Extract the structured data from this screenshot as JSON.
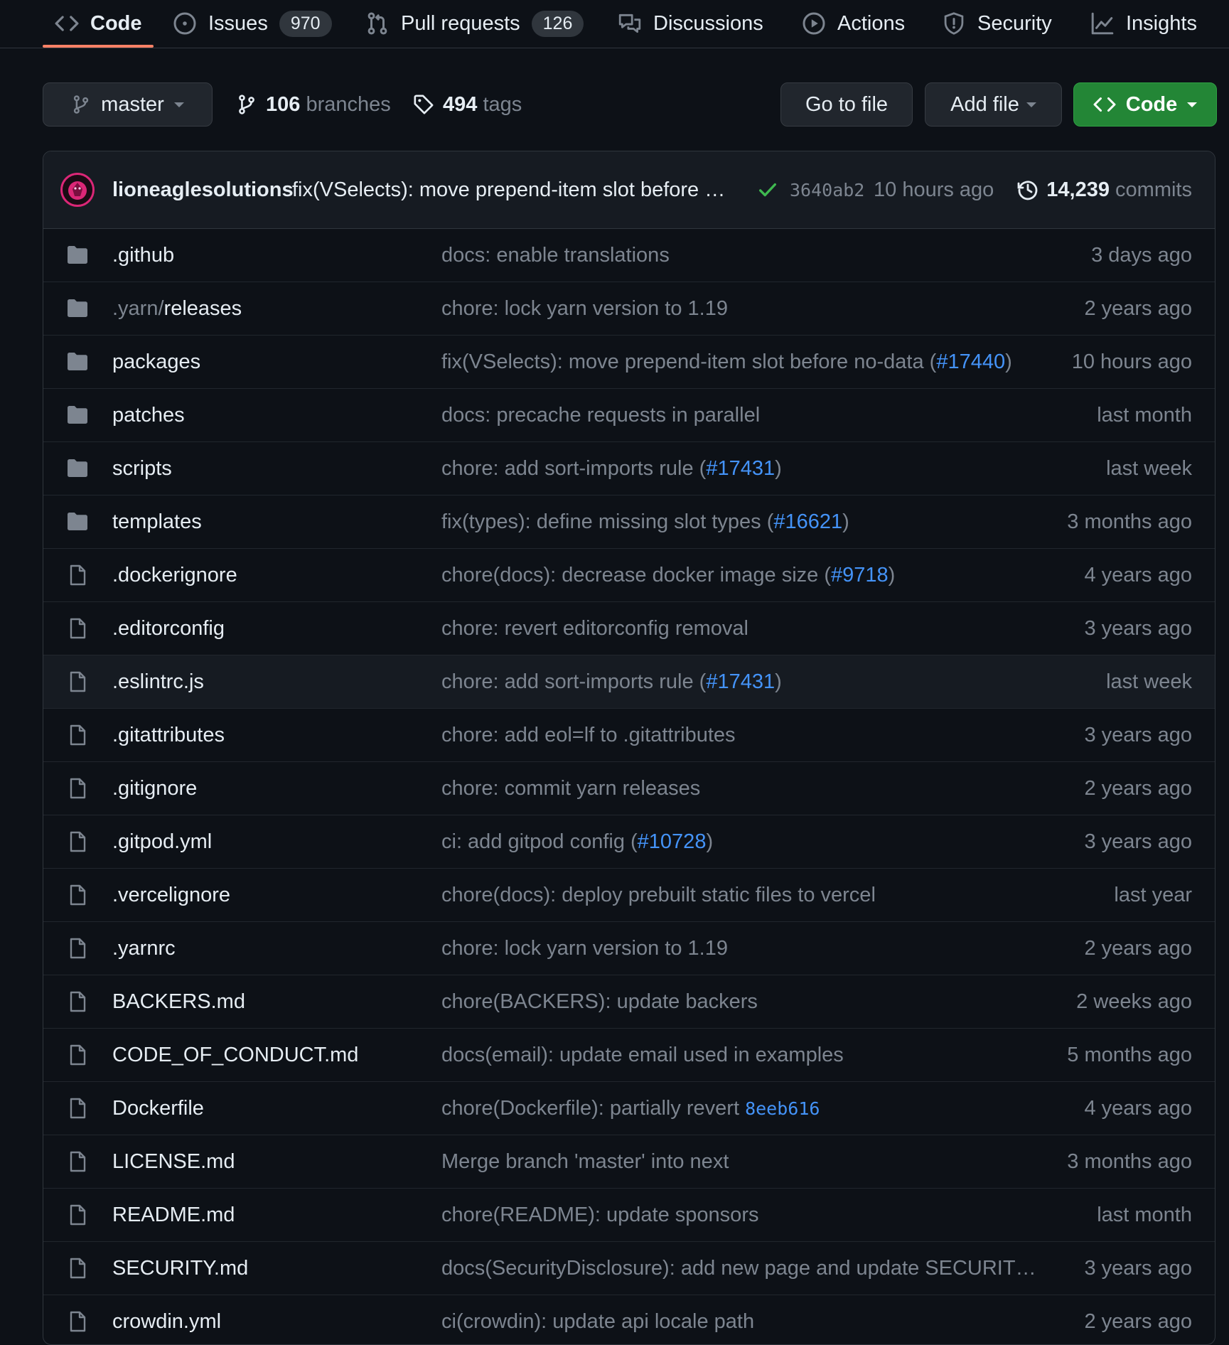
{
  "tabs": [
    {
      "label": "Code",
      "icon": "code-icon",
      "selected": true
    },
    {
      "label": "Issues",
      "icon": "issue-opened-icon",
      "count": "970"
    },
    {
      "label": "Pull requests",
      "icon": "git-pull-request-icon",
      "count": "126"
    },
    {
      "label": "Discussions",
      "icon": "comment-discussion-icon"
    },
    {
      "label": "Actions",
      "icon": "play-icon"
    },
    {
      "label": "Security",
      "icon": "shield-icon"
    },
    {
      "label": "Insights",
      "icon": "graph-icon"
    }
  ],
  "toolbar": {
    "branch": "master",
    "branches_count": "106",
    "branches_label": "branches",
    "tags_count": "494",
    "tags_label": "tags",
    "go_to_file": "Go to file",
    "add_file": "Add file",
    "code": "Code"
  },
  "latest_commit": {
    "author": "lioneaglesolutions",
    "message": "fix(VSelects): move prepend-item slot before …",
    "sha": "3640ab2",
    "time": "10 hours ago",
    "commits_count": "14,239",
    "commits_label": "commits"
  },
  "files": [
    {
      "type": "dir",
      "name": ".github",
      "msg": "docs: enable translations",
      "age": "3 days ago"
    },
    {
      "type": "dir",
      "name_dim": ".yarn/",
      "name": "releases",
      "msg": "chore: lock yarn version to 1.19",
      "age": "2 years ago"
    },
    {
      "type": "dir",
      "name": "packages",
      "msg": "fix(VSelects): move prepend-item slot before no-data (",
      "link": "#17440",
      "msg_after": ")",
      "age": "10 hours ago"
    },
    {
      "type": "dir",
      "name": "patches",
      "msg": "docs: precache requests in parallel",
      "age": "last month"
    },
    {
      "type": "dir",
      "name": "scripts",
      "msg": "chore: add sort-imports rule (",
      "link": "#17431",
      "msg_after": ")",
      "age": "last week"
    },
    {
      "type": "dir",
      "name": "templates",
      "msg": "fix(types): define missing slot types (",
      "link": "#16621",
      "msg_after": ")",
      "age": "3 months ago"
    },
    {
      "type": "file",
      "name": ".dockerignore",
      "msg": "chore(docs): decrease docker image size (",
      "link": "#9718",
      "msg_after": ")",
      "age": "4 years ago"
    },
    {
      "type": "file",
      "name": ".editorconfig",
      "msg": "chore: revert editorconfig removal",
      "age": "3 years ago"
    },
    {
      "type": "file",
      "name": ".eslintrc.js",
      "msg": "chore: add sort-imports rule (",
      "link": "#17431",
      "msg_after": ")",
      "age": "last week",
      "hover": true
    },
    {
      "type": "file",
      "name": ".gitattributes",
      "msg": "chore: add eol=lf to .gitattributes",
      "age": "3 years ago"
    },
    {
      "type": "file",
      "name": ".gitignore",
      "msg": "chore: commit yarn releases",
      "age": "2 years ago"
    },
    {
      "type": "file",
      "name": ".gitpod.yml",
      "msg": "ci: add gitpod config (",
      "link": "#10728",
      "msg_after": ")",
      "age": "3 years ago"
    },
    {
      "type": "file",
      "name": ".vercelignore",
      "msg": "chore(docs): deploy prebuilt static files to vercel",
      "age": "last year"
    },
    {
      "type": "file",
      "name": ".yarnrc",
      "msg": "chore: lock yarn version to 1.19",
      "age": "2 years ago"
    },
    {
      "type": "file",
      "name": "BACKERS.md",
      "msg": "chore(BACKERS): update backers",
      "age": "2 weeks ago"
    },
    {
      "type": "file",
      "name": "CODE_OF_CONDUCT.md",
      "msg": "docs(email): update email used in examples",
      "age": "5 months ago"
    },
    {
      "type": "file",
      "name": "Dockerfile",
      "msg": "chore(Dockerfile): partially revert ",
      "link": "8eeb616",
      "link_mono": true,
      "msg_after": "",
      "age": "4 years ago"
    },
    {
      "type": "file",
      "name": "LICENSE.md",
      "msg": "Merge branch 'master' into next",
      "age": "3 months ago"
    },
    {
      "type": "file",
      "name": "README.md",
      "msg": "chore(README): update sponsors",
      "age": "last month"
    },
    {
      "type": "file",
      "name": "SECURITY.md",
      "msg": "docs(SecurityDisclosure): add new page and update SECURIT…",
      "age": "3 years ago"
    },
    {
      "type": "file",
      "name": "crowdin.yml",
      "msg": "ci(crowdin): update api locale path",
      "age": "2 years ago"
    }
  ],
  "colors": {
    "accent": "#f78166",
    "link": "#4493f8",
    "green": "#238636",
    "check": "#3fb950",
    "avatar_ring": "#db2777"
  }
}
